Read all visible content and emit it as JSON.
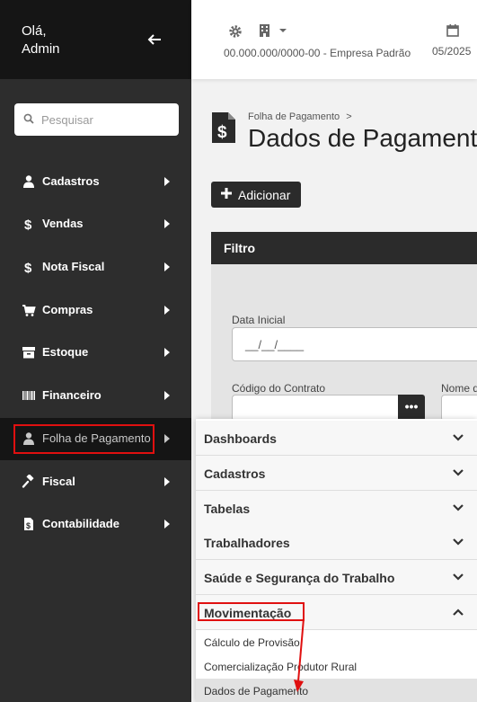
{
  "user": {
    "greeting_line1": "Olá,",
    "greeting_line2": "Admin"
  },
  "search": {
    "placeholder": "Pesquisar"
  },
  "sidebar": {
    "items": [
      {
        "label": "Cadastros",
        "icon": "user-icon"
      },
      {
        "label": "Vendas",
        "icon": "dollar-icon"
      },
      {
        "label": "Nota Fiscal",
        "icon": "dollar-icon"
      },
      {
        "label": "Compras",
        "icon": "cart-icon"
      },
      {
        "label": "Estoque",
        "icon": "archive-icon"
      },
      {
        "label": "Financeiro",
        "icon": "barcode-icon"
      },
      {
        "label": "Folha de Pagamento",
        "icon": "user-icon",
        "active": true
      },
      {
        "label": "Fiscal",
        "icon": "gavel-icon"
      },
      {
        "label": "Contabilidade",
        "icon": "file-icon"
      }
    ]
  },
  "topbar": {
    "company": "00.000.000/0000-00 - Empresa Padrão",
    "period": "05/2025"
  },
  "breadcrumb": {
    "parent": "Folha de Pagamento",
    "separator": ">"
  },
  "page": {
    "title": "Dados de Pagamento"
  },
  "actions": {
    "add_label": "Adicionar"
  },
  "filter": {
    "title": "Filtro",
    "data_inicial_label": "Data Inicial",
    "data_inicial_value": "__/__/____",
    "codigo_contrato_label": "Código do Contrato",
    "nome_label": "Nome d",
    "lookup_label": "•••"
  },
  "submenu": {
    "sections": [
      {
        "label": "Dashboards",
        "expanded": false
      },
      {
        "label": "Cadastros",
        "expanded": false
      },
      {
        "label": "Tabelas",
        "expanded": false
      },
      {
        "label": "Trabalhadores",
        "expanded": false
      },
      {
        "label": "Saúde e Segurança do Trabalho",
        "expanded": false
      },
      {
        "label": "Movimentação",
        "expanded": true
      }
    ],
    "items": [
      {
        "label": "Cálculo de Provisão"
      },
      {
        "label": "Comercialização Produtor Rural"
      },
      {
        "label": "Dados de Pagamento",
        "active": true
      }
    ]
  },
  "colors": {
    "sidebar_bg": "#2d2d2d",
    "header_bg": "#151515",
    "highlight": "#e01010",
    "button_bg": "#2b2b2b"
  }
}
